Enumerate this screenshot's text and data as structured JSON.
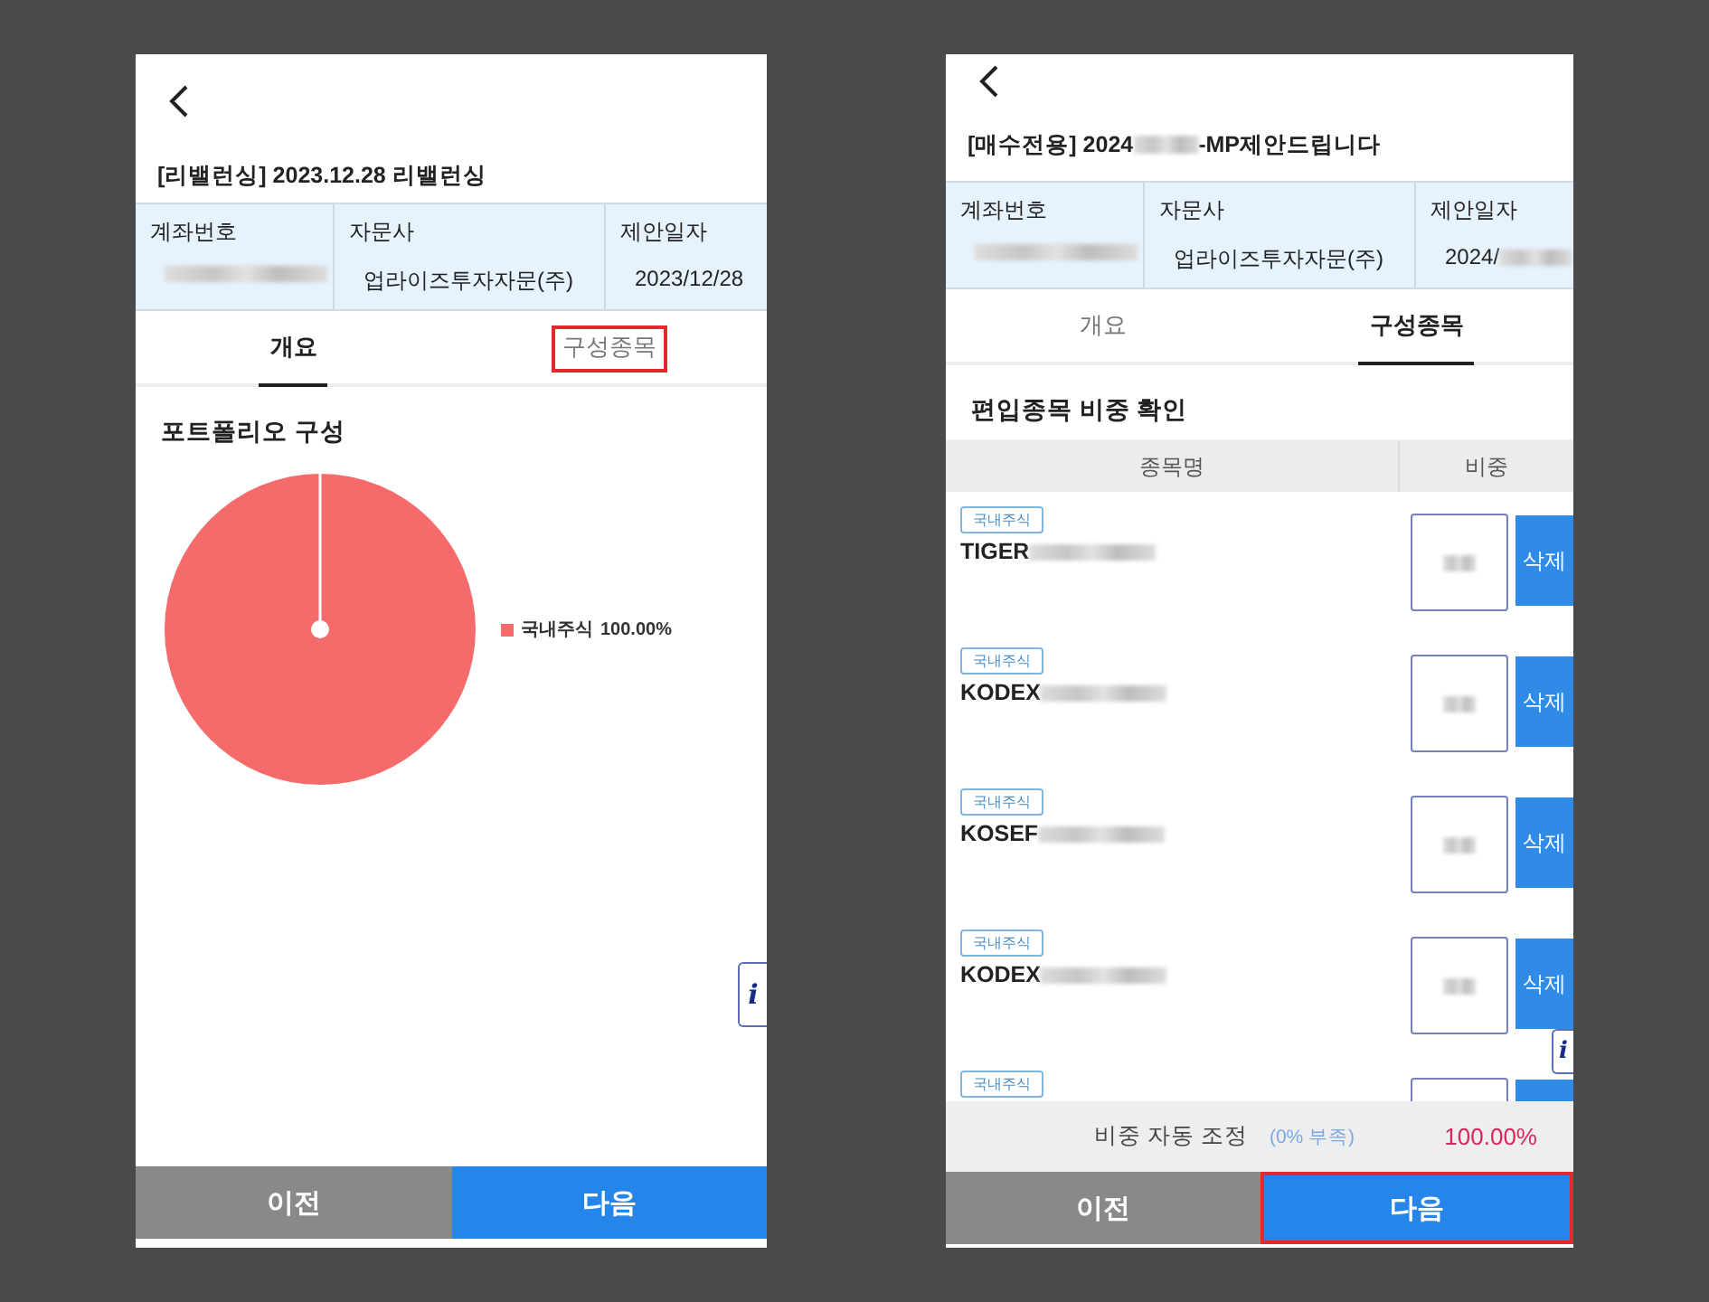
{
  "screens": [
    {
      "kind": "overview",
      "title": [
        {
          "kind": "text",
          "text": "[리밸런싱] 2023.12.28 리밸런싱"
        }
      ],
      "info": [
        {
          "label": "계좌번호",
          "redacted": true
        },
        {
          "label": "자문사",
          "value": "업라이즈투자자문(주)",
          "redacted": false
        },
        {
          "label": "제안일자",
          "value": "2023/12/28",
          "redacted": false
        }
      ],
      "tabs": [
        {
          "label": "개요",
          "selected": true,
          "highlighted": false
        },
        {
          "label": "구성종목",
          "selected": false,
          "highlighted": true
        }
      ],
      "section_title": "포트폴리오 구성",
      "chart_data": {
        "type": "pie",
        "categories": [
          "국내주식"
        ],
        "values": [
          100
        ],
        "needle": "국내주식"
      },
      "legend": [
        {
          "value": "100.00%",
          "color": "#f56a6a"
        }
      ],
      "info_button": "i",
      "buttons": [
        {
          "label": "이전",
          "kind": "prev",
          "highlighted": false
        },
        {
          "label": "다음",
          "kind": "next",
          "highlighted": false
        }
      ]
    },
    {
      "kind": "holdings",
      "title": [
        {
          "kind": "text",
          "text": "[매수전용] 2024"
        },
        {
          "kind": "redacted"
        },
        {
          "kind": "text",
          "text": "-MP제안드립니다"
        }
      ],
      "info": [
        {
          "label": "계좌번호",
          "redacted": true
        },
        {
          "label": "자문사",
          "value": "업라이즈투자자문(주)",
          "redacted": false
        },
        {
          "label": "제안일자",
          "value": "2024/",
          "redacted": true
        }
      ],
      "tabs": [
        {
          "label": "개요",
          "selected": false,
          "highlighted": false
        },
        {
          "label": "구성종목",
          "selected": true,
          "highlighted": false
        }
      ],
      "section_title": "편입종목 비중 확인",
      "table": {
        "columns": [
          "종목명",
          "비중"
        ],
        "rows": [
          {
            "tag": "국내주식",
            "name": "TIGER",
            "action": "삭제"
          },
          {
            "tag": "국내주식",
            "name": "KODEX",
            "action": "삭제"
          },
          {
            "tag": "국내주식",
            "name": "KOSEF",
            "action": "삭제"
          },
          {
            "tag": "국내주식",
            "name": "KODEX",
            "action": "삭제"
          },
          {
            "tag": "국내주식"
          }
        ]
      },
      "summary": {
        "label": "비중 자동 조정",
        "note": "(0% 부족)",
        "total": "100.00%"
      },
      "info_button": "i",
      "buttons": [
        {
          "label": "이전",
          "kind": "prev",
          "highlighted": false
        },
        {
          "label": "다음",
          "kind": "next",
          "highlighted": true
        }
      ]
    }
  ]
}
